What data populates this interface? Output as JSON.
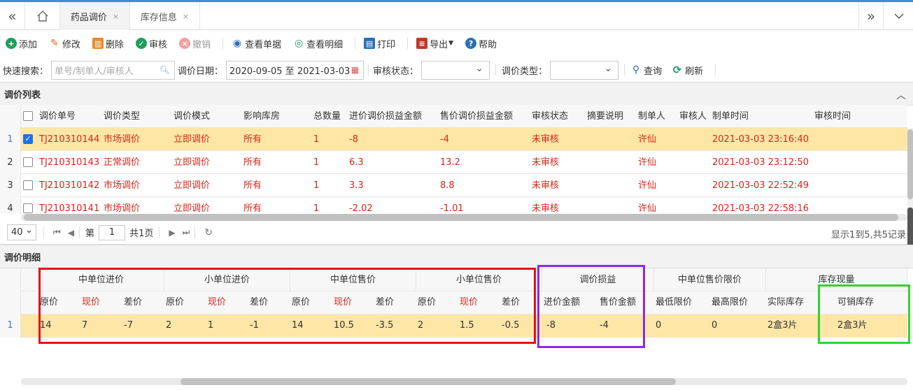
{
  "tabs": {
    "home_icon": "home-icon",
    "items": [
      {
        "label": "药品调价",
        "close": "×"
      },
      {
        "label": "库存信息",
        "close": "×"
      }
    ]
  },
  "toolbar": {
    "add": "添加",
    "edit": "修改",
    "delete": "删除",
    "audit": "审核",
    "revoke": "撤销",
    "view_doc": "查看单据",
    "view_detail": "查看明细",
    "print": "打印",
    "export": "导出",
    "help": "帮助"
  },
  "search": {
    "quick_label": "快速搜索：",
    "quick_placeholder": "单号/制单人/审核人",
    "date_label": "调价日期：",
    "date_value": "2020-09-05 至 2021-03-03",
    "audit_label": "审核状态：",
    "audit_value": "",
    "type_label": "调价类型：",
    "type_value": "",
    "query": "查询",
    "refresh": "刷新"
  },
  "list_panel": {
    "title": "调价列表",
    "columns": [
      "调价单号",
      "调价类型",
      "调价模式",
      "影响库房",
      "总数量",
      "进价调价损益金额",
      "售价调价损益金额",
      "审核状态",
      "摘要说明",
      "制单人",
      "审核人",
      "制单时间",
      "审核时间"
    ],
    "rows": [
      {
        "n": "1",
        "checked": true,
        "c": [
          "TJ210310144",
          "市场调价",
          "立即调价",
          "所有",
          "1",
          "-8",
          "-4",
          "未审核",
          "",
          "许仙",
          "",
          "2021-03-03 23:16:40",
          ""
        ]
      },
      {
        "n": "2",
        "checked": false,
        "c": [
          "TJ210310143",
          "正常调价",
          "立即调价",
          "所有",
          "1",
          "6.3",
          "13.2",
          "未审核",
          "",
          "许仙",
          "",
          "2021-03-03 23:12:50",
          ""
        ]
      },
      {
        "n": "3",
        "checked": false,
        "c": [
          "TJ210310142",
          "市场调价",
          "立即调价",
          "所有",
          "1",
          "3.3",
          "8.8",
          "未审核",
          "",
          "许仙",
          "",
          "2021-03-03 22:52:49",
          ""
        ]
      },
      {
        "n": "4",
        "checked": false,
        "c": [
          "TJ210310141",
          "市场调价",
          "立即调价",
          "所有",
          "1",
          "-2.02",
          "-1.01",
          "未审核",
          "",
          "许仙",
          "",
          "2021-03-03 22:58:16",
          ""
        ]
      }
    ]
  },
  "pager": {
    "page_size": "40",
    "page_prefix": "第",
    "page": "1",
    "page_suffix": "共1页",
    "info": "显示1到5,共5记录"
  },
  "detail_panel": {
    "title": "调价明细",
    "groups": [
      "中单位进价",
      "小单位进价",
      "中单位售价",
      "小单位售价",
      "调价损益",
      "中单位售价限价",
      "库存现量"
    ],
    "columns": [
      "原价",
      "现价",
      "差价",
      "原价",
      "现价",
      "差价",
      "原价",
      "现价",
      "差价",
      "原价",
      "现价",
      "差价",
      "进价金额",
      "售价金额",
      "最低限价",
      "最高限价",
      "实际库存",
      "可销库存"
    ],
    "row": {
      "n": "1",
      "c": [
        "14",
        "7",
        "-7",
        "2",
        "1",
        "-1",
        "14",
        "10.5",
        "-3.5",
        "2",
        "1.5",
        "-0.5",
        "-8",
        "-4",
        "0",
        "0",
        "2盒3片",
        "2盒3片"
      ]
    }
  },
  "highlights": {
    "red": "#e3101e",
    "purple": "#8a2be2",
    "green": "#2ed42e"
  }
}
